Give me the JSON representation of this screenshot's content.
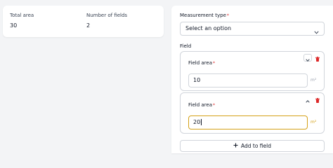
{
  "summary": {
    "total_area_label": "Total area",
    "total_area_value": "30",
    "number_of_fields_label": "Number of fields",
    "number_of_fields_value": "2"
  },
  "form": {
    "measurement_type_label": "Measurement type",
    "required_marker": "*",
    "measurement_type_value": "Select an option",
    "field_section_label": "Field",
    "fields": [
      {
        "label": "Field area",
        "value": "10",
        "unit": "m²",
        "collapse_icon": "chevron-down-icon",
        "delete_icon": "trash-icon"
      },
      {
        "label": "Field area",
        "value": "20",
        "unit": "m²",
        "collapse_icon": "chevron-up-icon",
        "delete_icon": "trash-icon"
      }
    ],
    "add_button_label": "Add to field"
  },
  "colors": {
    "danger": "#dc2626",
    "focus": "#d4a017",
    "border": "#d1d5db"
  }
}
